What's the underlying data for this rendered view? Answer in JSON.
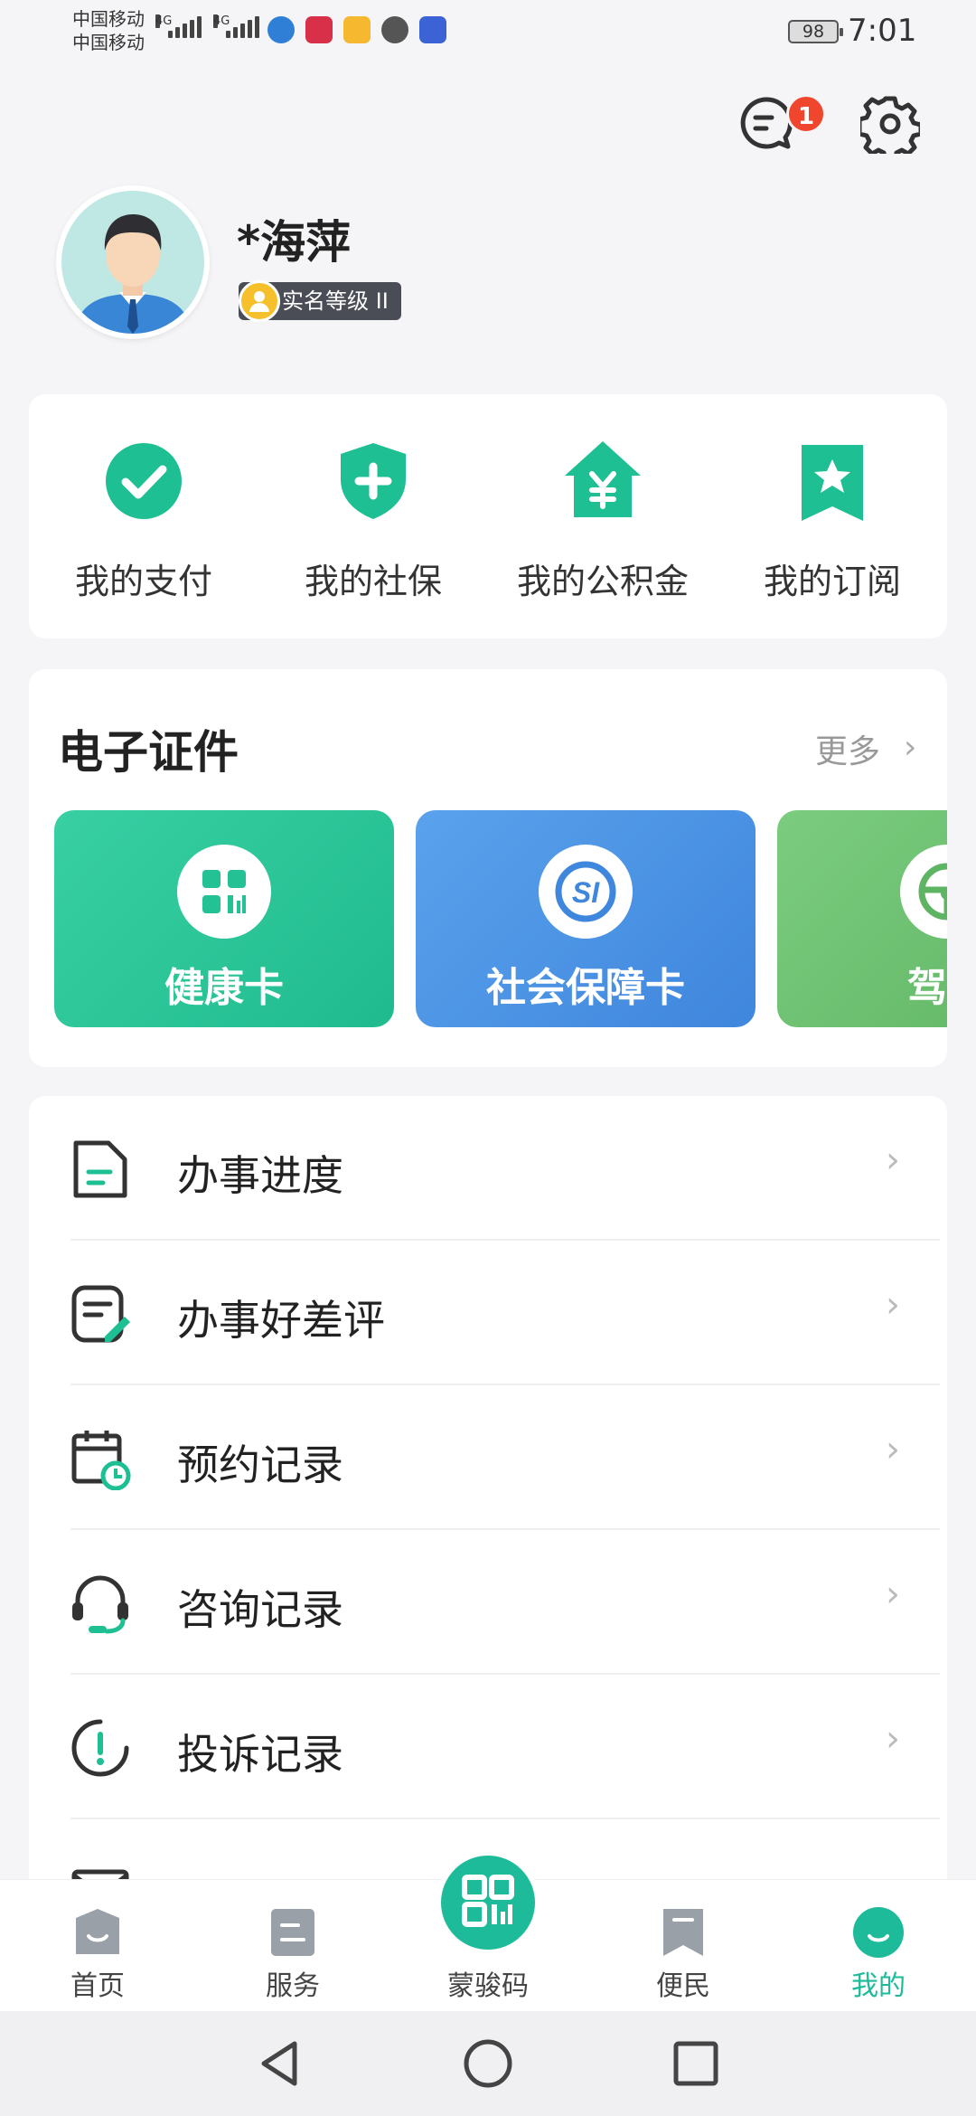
{
  "status_bar": {
    "carrier_1": "中国移动",
    "carrier_2": "中国移动",
    "network_1": "4G",
    "network_2": "4G",
    "battery": "98",
    "time": "7:01"
  },
  "header": {
    "message_badge": "1"
  },
  "profile": {
    "name": "*海萍",
    "verification_level": "实名等级 II"
  },
  "quick_actions": [
    {
      "label": "我的支付",
      "icon": "check-circle-icon"
    },
    {
      "label": "我的社保",
      "icon": "shield-plus-icon"
    },
    {
      "label": "我的公积金",
      "icon": "house-yen-icon"
    },
    {
      "label": "我的订阅",
      "icon": "bookmark-star-icon"
    }
  ],
  "certificates": {
    "title": "电子证件",
    "more_label": "更多",
    "cards": [
      {
        "label": "健康卡",
        "color": "#2cc59a",
        "icon": "qr-grid-icon"
      },
      {
        "label": "社会保障卡",
        "color": "#4a90e2",
        "icon": "si-logo-icon"
      },
      {
        "label": "驾驶",
        "color": "#6cc070",
        "icon": "steering-wheel-icon"
      }
    ]
  },
  "menu": [
    {
      "label": "办事进度",
      "icon": "document-progress-icon"
    },
    {
      "label": "办事好差评",
      "icon": "review-edit-icon"
    },
    {
      "label": "预约记录",
      "icon": "calendar-clock-icon"
    },
    {
      "label": "咨询记录",
      "icon": "headset-icon"
    },
    {
      "label": "投诉记录",
      "icon": "alert-circle-icon"
    }
  ],
  "tab_bar": [
    {
      "label": "首页",
      "icon": "home-icon",
      "active": false
    },
    {
      "label": "服务",
      "icon": "service-icon",
      "active": false
    },
    {
      "label": "蒙骏码",
      "icon": "qr-code-icon",
      "active": false
    },
    {
      "label": "便民",
      "icon": "bookmark-icon",
      "active": false
    },
    {
      "label": "我的",
      "icon": "profile-icon",
      "active": true
    }
  ],
  "colors": {
    "accent": "#1dbb99",
    "badge": "#f0462d",
    "health_card": "#2cc59a",
    "social_security_card": "#4a90e2",
    "driving_card": "#6cc070"
  }
}
